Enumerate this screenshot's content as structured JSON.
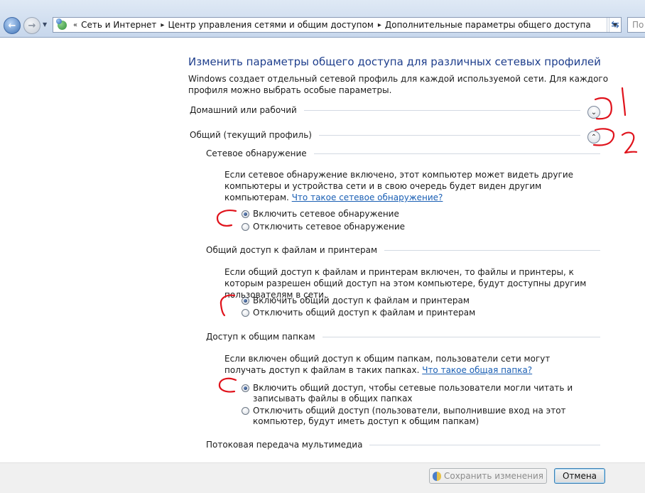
{
  "breadcrumb": {
    "items": [
      "Сеть и Интернет",
      "Центр управления сетями и общим доступом",
      "Дополнительные параметры общего доступа"
    ]
  },
  "search": {
    "placeholder": "По"
  },
  "main": {
    "title": "Изменить параметры общего доступа для различных сетевых профилей",
    "description": "Windows создает отдельный сетевой профиль для каждой используемой сети. Для каждого профиля можно выбрать особые параметры."
  },
  "profiles": [
    {
      "label": "Домашний или рабочий",
      "expanded": false
    },
    {
      "label": "Общий (текущий профиль)",
      "expanded": true
    }
  ],
  "sections": {
    "discovery": {
      "heading": "Сетевое обнаружение",
      "text": "Если сетевое обнаружение включено, этот компьютер может видеть другие компьютеры и устройства сети и в свою очередь будет виден другим компьютерам.",
      "link": "Что такое сетевое обнаружение?",
      "options": [
        {
          "label": "Включить сетевое обнаружение",
          "checked": true
        },
        {
          "label": "Отключить сетевое обнаружение",
          "checked": false
        }
      ]
    },
    "files": {
      "heading": "Общий доступ к файлам и принтерам",
      "text": "Если общий доступ к файлам и принтерам включен, то файлы и принтеры, к которым разрешен общий доступ на этом компьютере, будут доступны другим пользователям в сети.",
      "options": [
        {
          "label": "Включить общий доступ к файлам и принтерам",
          "checked": true
        },
        {
          "label": "Отключить общий доступ к файлам и принтерам",
          "checked": false
        }
      ]
    },
    "public_folders": {
      "heading": "Доступ к общим папкам",
      "text": "Если включен общий доступ к общим папкам, пользователи сети могут получать доступ к файлам в таких папках.",
      "link": "Что такое общая папка?",
      "options": [
        {
          "label": "Включить общий доступ, чтобы сетевые пользователи могли читать и записывать файлы в общих папках",
          "checked": true
        },
        {
          "label": "Отключить общий доступ (пользователи, выполнившие вход на этот компьютер, будут иметь доступ к общим папкам)",
          "checked": false
        }
      ]
    },
    "streaming": {
      "heading": "Потоковая передача мультимедиа"
    }
  },
  "buttons": {
    "save": "Сохранить изменения",
    "cancel": "Отмена"
  },
  "annotations": [
    "1",
    "2"
  ],
  "colors": {
    "title": "#1e3e8c",
    "link": "#1a5fb4",
    "annotation": "#e0121b"
  }
}
